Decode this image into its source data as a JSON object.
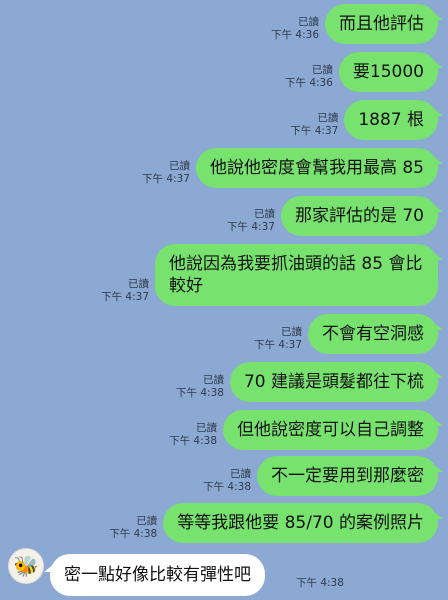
{
  "outgoing": [
    {
      "read": "已讀",
      "time": "下午 4:36",
      "text": "而且他評估"
    },
    {
      "read": "已讀",
      "time": "下午 4:36",
      "text": "要15000"
    },
    {
      "read": "已讀",
      "time": "下午 4:37",
      "text": "1887 根"
    },
    {
      "read": "已讀",
      "time": "下午 4:37",
      "text": "他說他密度會幫我用最高 85"
    },
    {
      "read": "已讀",
      "time": "下午 4:37",
      "text": "那家評估的是 70"
    },
    {
      "read": "已讀",
      "time": "下午 4:37",
      "text": "他說因為我要抓油頭的話 85 會比較好"
    },
    {
      "read": "已讀",
      "time": "下午 4:37",
      "text": "不會有空洞感"
    },
    {
      "read": "已讀",
      "time": "下午 4:38",
      "text": "70 建議是頭髮都往下梳"
    },
    {
      "read": "已讀",
      "time": "下午 4:38",
      "text": "但他說密度可以自己調整"
    },
    {
      "read": "已讀",
      "time": "下午 4:38",
      "text": "不一定要用到那麼密"
    },
    {
      "read": "已讀",
      "time": "下午 4:38",
      "text": "等等我跟他要 85/70 的案例照片"
    }
  ],
  "incoming": {
    "text": "密一點好像比較有彈性吧",
    "time": "下午 4:38"
  },
  "colors": {
    "background": "#8ba9d2",
    "outgoing_bubble": "#78e26f",
    "incoming_bubble": "#ffffff"
  }
}
